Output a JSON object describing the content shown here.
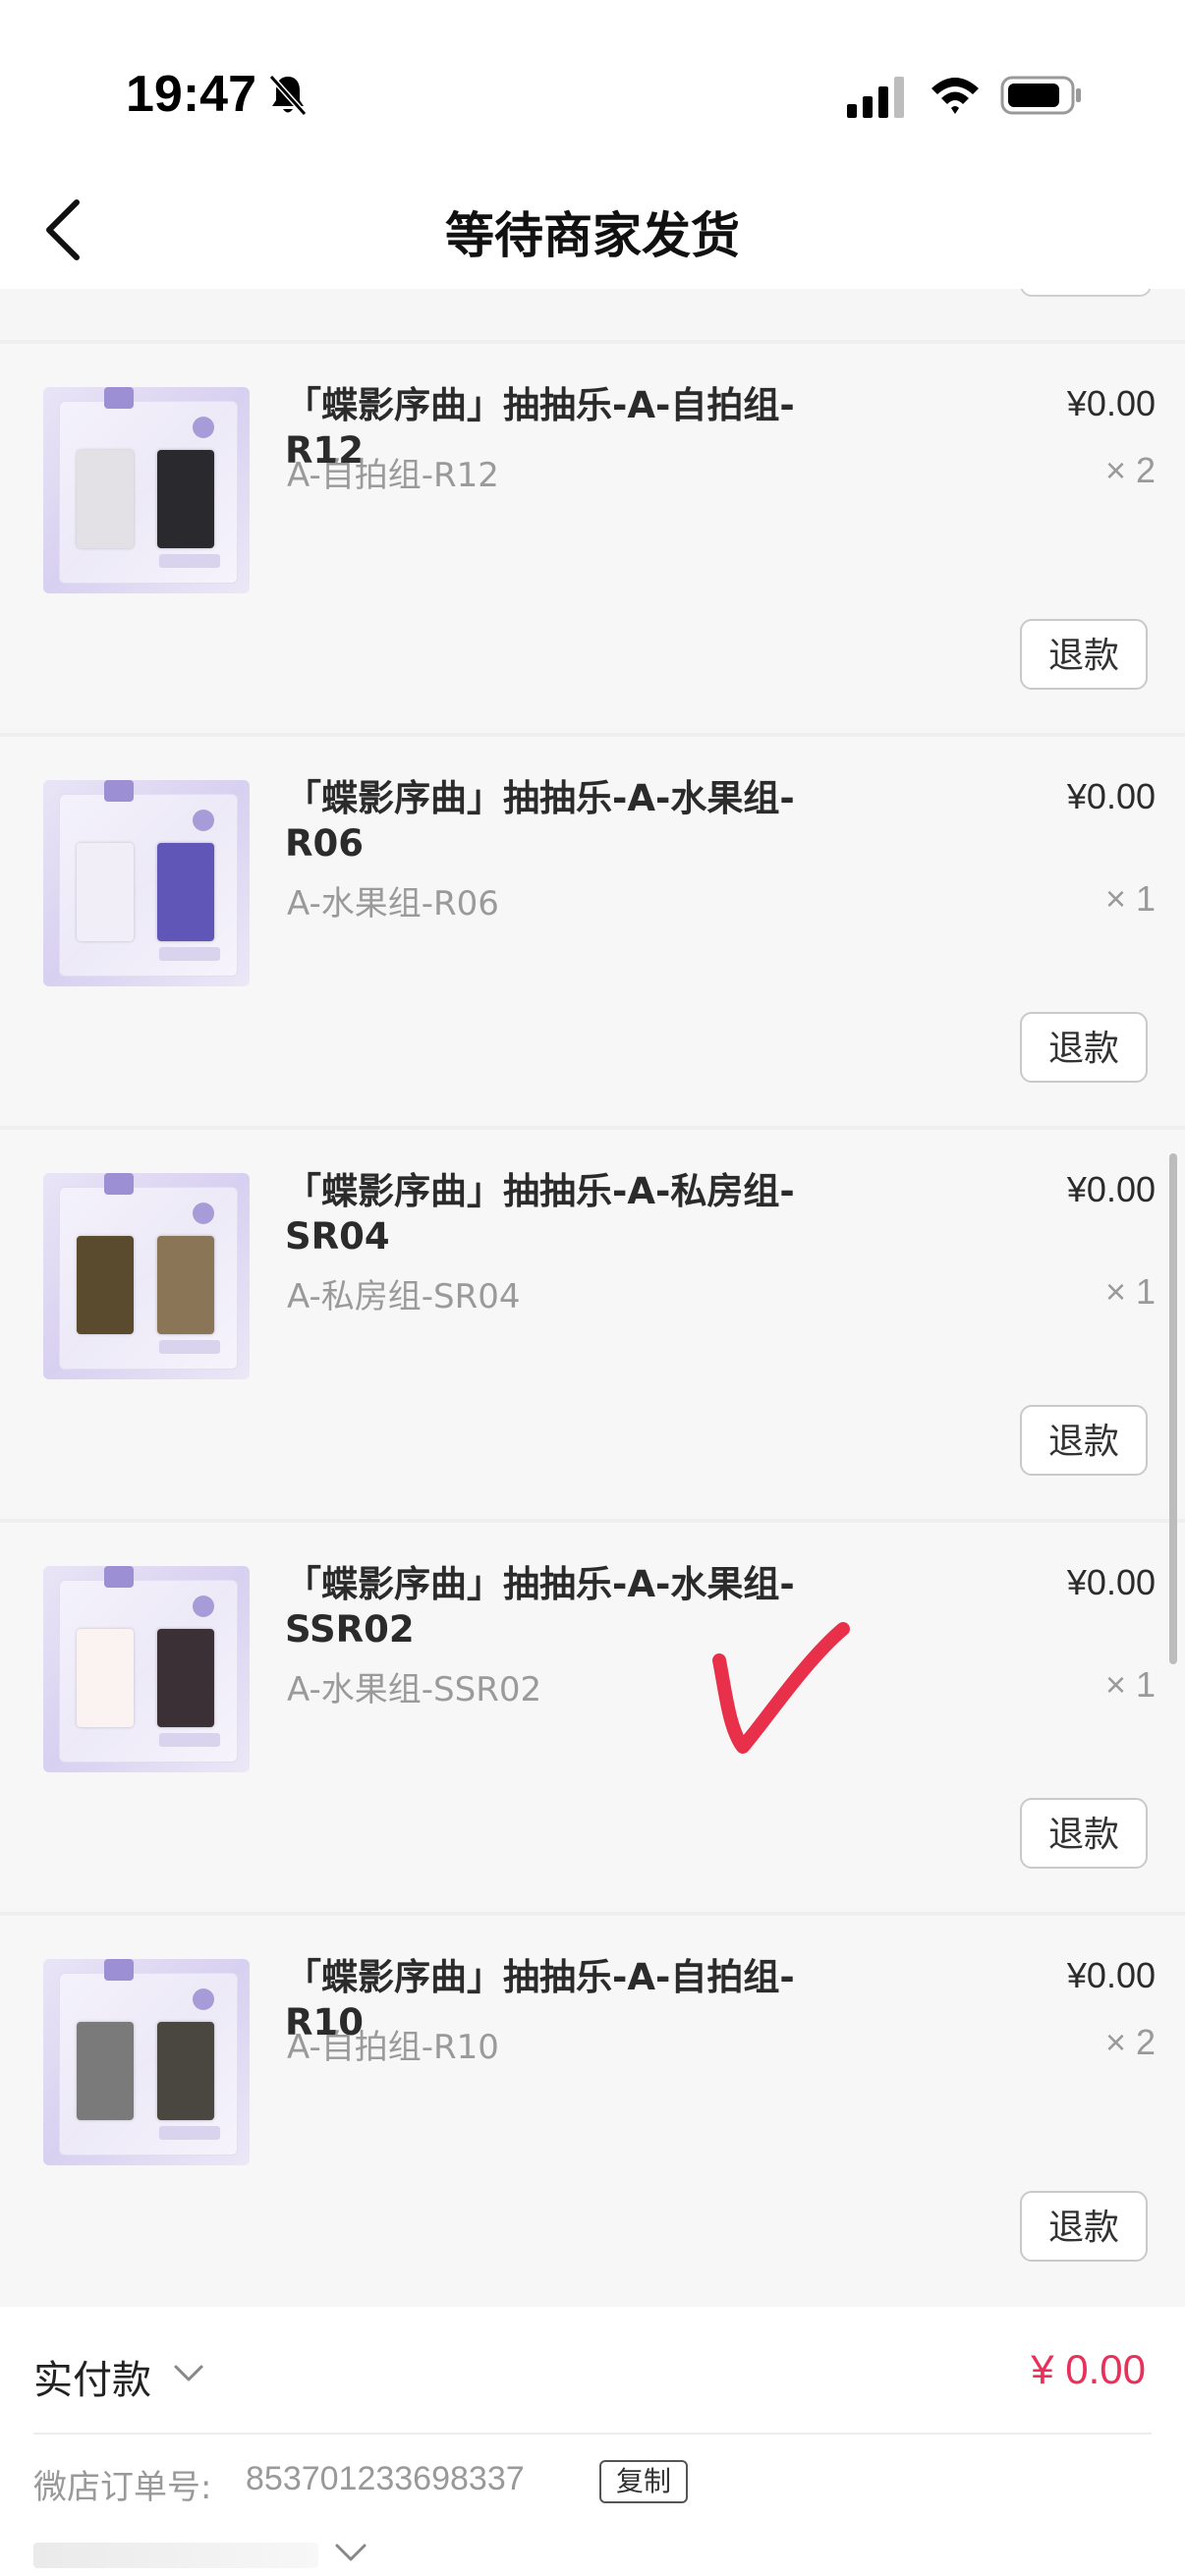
{
  "status_bar": {
    "time": "19:47",
    "icons": [
      "bell-slash-icon",
      "cellular-signal-icon",
      "wifi-icon",
      "battery-icon"
    ]
  },
  "nav": {
    "title": "等待商家发货",
    "back_icon": "chevron-left-icon"
  },
  "items": [
    {
      "title": "「蝶影序曲」抽抽乐-A-自拍组-R12",
      "spec": "A-自拍组-R12",
      "price": "¥0.00",
      "qty": "× 2",
      "refund_label": "退款"
    },
    {
      "title": "「蝶影序曲」抽抽乐-A-水果组-R06",
      "spec": "A-水果组-R06",
      "price": "¥0.00",
      "qty": "× 1",
      "refund_label": "退款"
    },
    {
      "title": "「蝶影序曲」抽抽乐-A-私房组-SR04",
      "spec": "A-私房组-SR04",
      "price": "¥0.00",
      "qty": "× 1",
      "refund_label": "退款"
    },
    {
      "title": "「蝶影序曲」抽抽乐-A-水果组-SSR02",
      "spec": "A-水果组-SSR02",
      "price": "¥0.00",
      "qty": "× 1",
      "refund_label": "退款"
    },
    {
      "title": "「蝶影序曲」抽抽乐-A-自拍组-R10",
      "spec": "A-自拍组-R10",
      "price": "¥0.00",
      "qty": "× 2",
      "refund_label": "退款"
    }
  ],
  "summary": {
    "paid_label": "实付款",
    "paid_amount": "¥ 0.00",
    "order_label": "微店订单号:",
    "order_number": "853701233698337",
    "copy_label": "复制"
  },
  "colors": {
    "accent_price": "#e8305a",
    "checkmark": "#e8304a",
    "background": "#f6f6f6"
  }
}
